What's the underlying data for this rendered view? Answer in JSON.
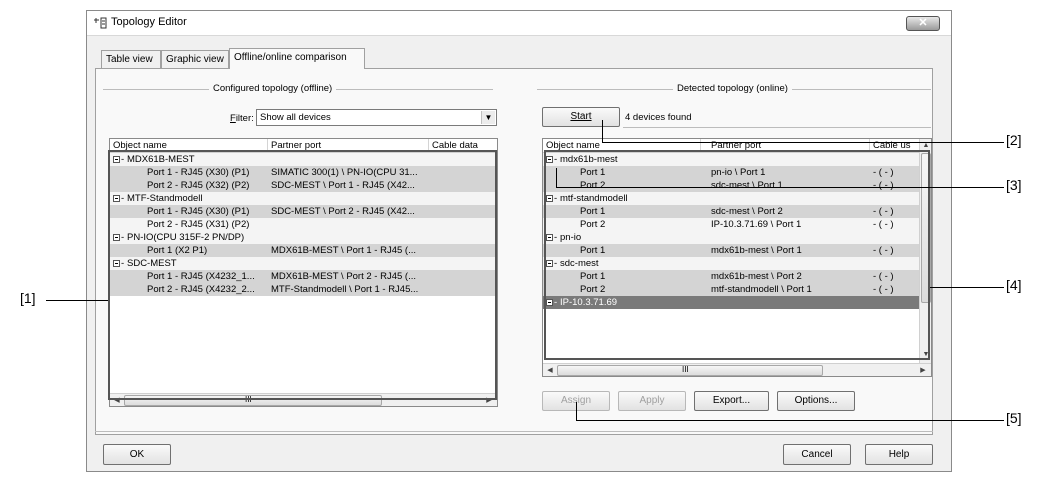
{
  "window": {
    "title": "Topology Editor",
    "close_icon": "close-icon"
  },
  "tabs": [
    {
      "label": "Table view"
    },
    {
      "label": "Graphic view"
    },
    {
      "label": "Offline/online comparison"
    }
  ],
  "offline": {
    "group_label": "Configured topology (offline)",
    "filter_label": "Filter:",
    "filter_value": "Show all devices",
    "columns": [
      "Object name",
      "Partner port",
      "Cable data"
    ],
    "rows": [
      {
        "name": "MDX61B-MEST",
        "partner": "",
        "group": true
      },
      {
        "name": "Port 1 - RJ45 (X30) (P1)",
        "partner": "SIMATIC 300(1) \\ PN-IO(CPU 31..."
      },
      {
        "name": "Port 2 - RJ45 (X32) (P2)",
        "partner": "SDC-MEST \\ Port 1 - RJ45 (X42..."
      },
      {
        "name": "MTF-Standmodell",
        "partner": "",
        "group": true
      },
      {
        "name": "Port 1 - RJ45 (X30) (P1)",
        "partner": "SDC-MEST \\ Port 2 - RJ45 (X42..."
      },
      {
        "name": "Port 2 - RJ45 (X31) (P2)",
        "partner": ""
      },
      {
        "name": "PN-IO(CPU 315F-2 PN/DP)",
        "partner": "",
        "group": true
      },
      {
        "name": "Port 1 (X2 P1)",
        "partner": "MDX61B-MEST \\ Port 1 - RJ45 (..."
      },
      {
        "name": "SDC-MEST",
        "partner": "",
        "group": true
      },
      {
        "name": "Port 1 - RJ45 (X4232_1...",
        "partner": "MDX61B-MEST \\ Port 2 - RJ45 (..."
      },
      {
        "name": "Port 2 - RJ45 (X4232_2...",
        "partner": "MTF-Standmodell \\ Port 1 - RJ45..."
      }
    ],
    "scroll_mark": "III"
  },
  "online": {
    "group_label": "Detected topology (online)",
    "start_label": "Start",
    "status": "4 devices found",
    "columns": [
      "Object name",
      "Partner port",
      "Cable us"
    ],
    "rows": [
      {
        "name": "mdx61b-mest",
        "partner": "",
        "cable": "",
        "group": true
      },
      {
        "name": "Port 1",
        "partner": "pn-io \\ Port 1",
        "cable": "- ( - )"
      },
      {
        "name": "Port 2",
        "partner": "sdc-mest \\ Port 1",
        "cable": "- ( - )"
      },
      {
        "name": "mtf-standmodell",
        "partner": "",
        "cable": "",
        "group": true
      },
      {
        "name": "Port 1",
        "partner": "sdc-mest \\ Port 2",
        "cable": "- ( - )"
      },
      {
        "name": "Port 2",
        "partner": "IP-10.3.71.69 \\ Port 1",
        "cable": "- ( - )"
      },
      {
        "name": "pn-io",
        "partner": "",
        "cable": "",
        "group": true
      },
      {
        "name": "Port 1",
        "partner": "mdx61b-mest \\ Port 1",
        "cable": "- ( - )"
      },
      {
        "name": "sdc-mest",
        "partner": "",
        "cable": "",
        "group": true
      },
      {
        "name": "Port 1",
        "partner": "mdx61b-mest \\ Port 2",
        "cable": "- ( - )"
      },
      {
        "name": "Port 2",
        "partner": "mtf-standmodell \\ Port 1",
        "cable": "- ( - )"
      },
      {
        "name": "IP-10.3.71.69",
        "partner": "",
        "cable": "",
        "group": true,
        "selected": true
      }
    ],
    "scroll_mark": "III",
    "buttons": {
      "assign": "Assign",
      "apply": "Apply",
      "export": "Export...",
      "options": "Options..."
    }
  },
  "footer": {
    "ok": "OK",
    "cancel": "Cancel",
    "help": "Help"
  },
  "callouts": [
    "[1]",
    "[2]",
    "[3]",
    "[4]",
    "[5]"
  ]
}
